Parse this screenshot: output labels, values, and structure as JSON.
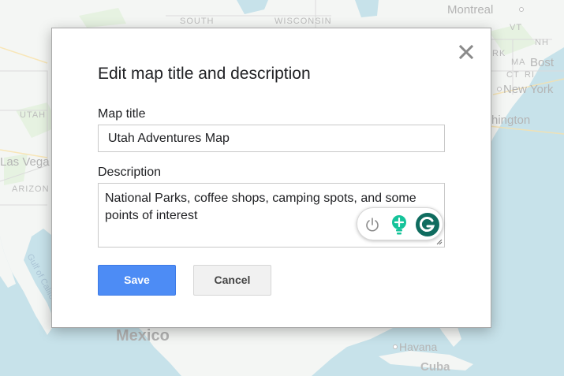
{
  "map": {
    "labels": {
      "south": "SOUTH",
      "wisconsin": "WISCONSIN",
      "montreal": "Montreal",
      "vt": "VT",
      "nh": "NH",
      "rk": "RK",
      "ma": "MA",
      "boston": "Bost",
      "ct": "CT",
      "ri": "RI",
      "new_york": "New York",
      "washington": "hington",
      "utah": "UTAH",
      "las_vegas": "Las Vega",
      "arizona": "ARIZON",
      "gulf": "Gulf of Califo",
      "mexico": "Mexico",
      "havana": "Havana",
      "cuba": "Cuba"
    },
    "colors": {
      "land": "#eef2ee",
      "water": "#aad3df",
      "park": "#d9ecd2"
    }
  },
  "dialog": {
    "title": "Edit map title and description",
    "close_icon": "close-icon",
    "map_title_label": "Map title",
    "map_title_value": "Utah Adventures Map",
    "description_label": "Description",
    "description_value": "National Parks, coffee shops, camping spots, and some points of interest",
    "save_label": "Save",
    "cancel_label": "Cancel",
    "colors": {
      "save_bg": "#4d8cf5",
      "cancel_bg": "#f1f1f1"
    }
  },
  "grammarly": {
    "icons": [
      "power-icon",
      "lightbulb-icon",
      "grammarly-g-icon"
    ],
    "colors": {
      "brand": "#15c39a",
      "g_bg": "#0f6c5f"
    }
  }
}
